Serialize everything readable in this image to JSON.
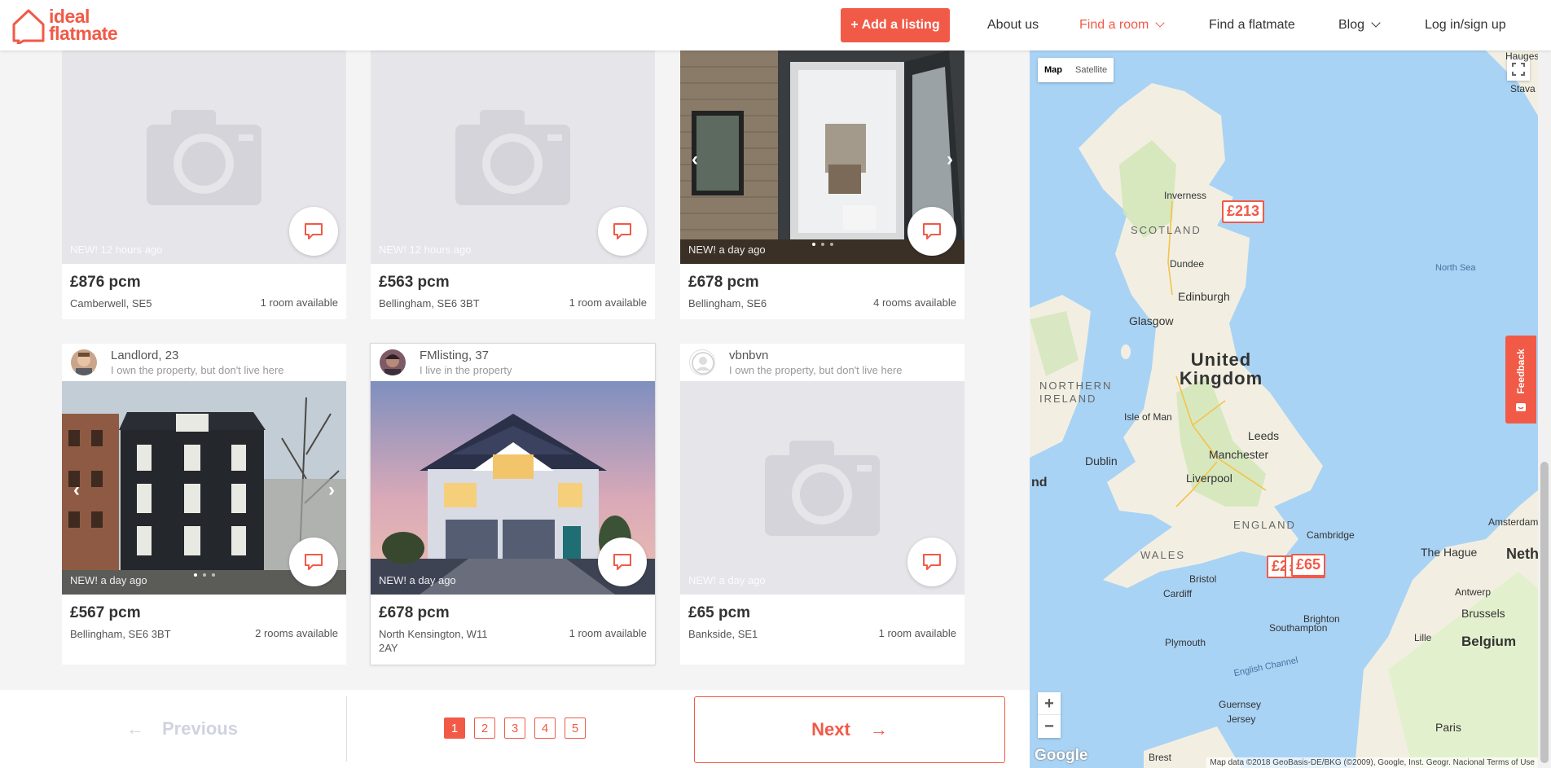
{
  "header": {
    "brand_line1": "ideal",
    "brand_line2": "flatmate",
    "add_listing": "+ Add a listing",
    "nav": {
      "about": "About us",
      "find_room": "Find a room",
      "find_flatmate": "Find a flatmate",
      "blog": "Blog",
      "login": "Log in/sign up"
    },
    "accent_color": "#f15a47"
  },
  "listings": [
    {
      "photo": "camera-placeholder",
      "posted": "NEW! 12 hours ago",
      "price": "£876 pcm",
      "location": "Camberwell, SE5",
      "rooms": "1 room available"
    },
    {
      "photo": "camera-placeholder",
      "posted": "NEW! 12 hours ago",
      "price": "£563 pcm",
      "location": "Bellingham, SE6 3BT",
      "rooms": "1 room available"
    },
    {
      "photo": "kitchen-extension-photo",
      "posted": "NEW! a day ago",
      "price": "£678 pcm",
      "location": "Bellingham, SE6",
      "rooms": "4 rooms available"
    },
    {
      "owner": "Landlord, 23",
      "owner_note": "I own the property, but don't live here",
      "photo": "townhouse-photo",
      "posted": "NEW! a day ago",
      "price": "£567 pcm",
      "location": "Bellingham, SE6 3BT",
      "rooms": "2 rooms available"
    },
    {
      "owner": "FMlisting, 37",
      "owner_note": "I live in the property",
      "photo": "suburban-house-photo",
      "posted": "NEW! a day ago",
      "price": "£678 pcm",
      "location": "North Kensington, W11 2AY",
      "rooms": "1 room available"
    },
    {
      "owner": "vbnbvn",
      "owner_note": "I own the property, but don't live here",
      "photo": "camera-placeholder",
      "posted": "NEW! a day ago",
      "price": "£65 pcm",
      "location": "Bankside, SE1",
      "rooms": "1 room available"
    }
  ],
  "pagination": {
    "previous": "Previous",
    "pages": [
      "1",
      "2",
      "3",
      "4",
      "5"
    ],
    "current_page": "1",
    "next": "Next"
  },
  "map": {
    "type_map": "Map",
    "type_satellite": "Satellite",
    "zoom_in": "+",
    "zoom_out": "−",
    "feedback": "Feedback",
    "google": "Google",
    "attribution": "Map data ©2018 GeoBasis-DE/BKG (©2009), Google, Inst. Geogr. Nacional   Terms of Use",
    "labels": {
      "haugesund": "Haugesund",
      "stavanger": "Stava",
      "inverness": "Inverness",
      "scotland": "SCOTLAND",
      "dundee": "Dundee",
      "north_sea": "North Sea",
      "edinburgh": "Edinburgh",
      "glasgow": "Glasgow",
      "united_kingdom": "United Kingdom",
      "northern_ireland": "NORTHERN IRELAND",
      "isle_of_man": "Isle of Man",
      "leeds": "Leeds",
      "manchester": "Manchester",
      "dublin": "Dublin",
      "ireland_cut": "nd",
      "liverpool": "Liverpool",
      "england": "ENGLAND",
      "cambridge": "Cambridge",
      "amsterdam": "Amsterdam",
      "wales": "WALES",
      "the_hague": "The Hague",
      "netherlands_cut": "Nethe",
      "bristol": "Bristol",
      "cardiff": "Cardiff",
      "antwerp": "Antwerp",
      "brussels": "Brussels",
      "southampton": "Southampton",
      "brighton": "Brighton",
      "lille": "Lille",
      "belgium": "Belgium",
      "plymouth": "Plymouth",
      "english_channel": "English Channel",
      "guernsey": "Guernsey",
      "jersey": "Jersey",
      "paris": "Paris",
      "brest": "Brest"
    },
    "markers": {
      "aberdeen": "£213",
      "london_left": "£2",
      "london_mid": "£",
      "london_front": "£65",
      "london_right": "67"
    }
  }
}
